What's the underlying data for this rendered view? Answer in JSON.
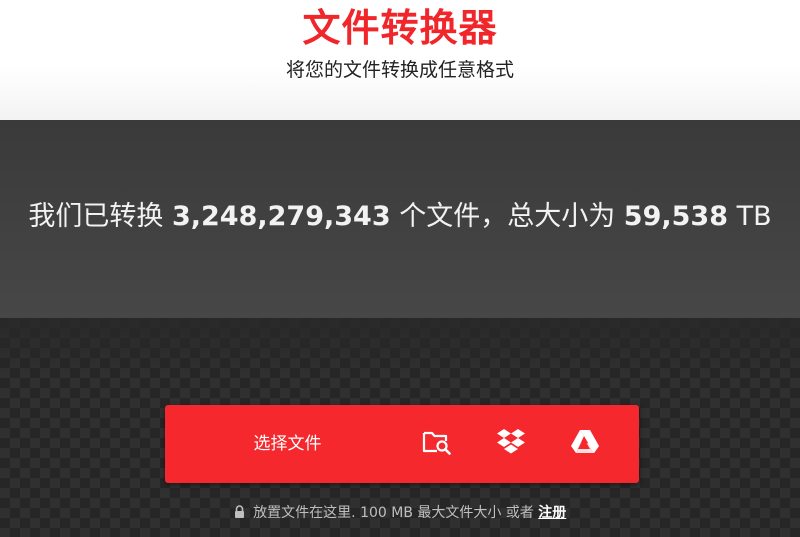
{
  "header": {
    "title": "文件转换器",
    "subtitle": "将您的文件转换成任意格式"
  },
  "stats": {
    "prefix": "我们已转换",
    "files_count": "3,248,279,343",
    "middle": "个文件，总大小为",
    "total_size": "59,538",
    "unit": "TB"
  },
  "upload": {
    "choose_label": "选择文件",
    "icons": {
      "device": "folder-search-icon",
      "dropbox": "dropbox-icon",
      "gdrive": "google-drive-icon"
    },
    "note_text": "放置文件在这里. 100 MB 最大文件大小 或者",
    "signup_label": "注册"
  },
  "colors": {
    "accent": "#f5282e",
    "title": "#f0262b",
    "band": "#424242",
    "dropzone": "#262626"
  }
}
